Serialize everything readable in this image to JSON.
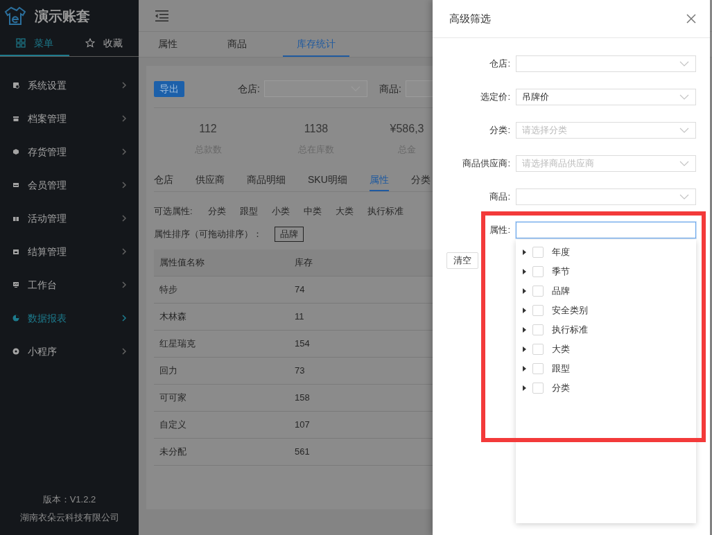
{
  "sidebar": {
    "app_name": "演示账套",
    "tabs": [
      {
        "label": "菜单",
        "selected": true
      },
      {
        "label": "收藏",
        "selected": false
      }
    ],
    "items": [
      {
        "label": "系统设置",
        "selected": false
      },
      {
        "label": "档案管理",
        "selected": false
      },
      {
        "label": "存货管理",
        "selected": false
      },
      {
        "label": "会员管理",
        "selected": false
      },
      {
        "label": "活动管理",
        "selected": false
      },
      {
        "label": "结算管理",
        "selected": false
      },
      {
        "label": "工作台",
        "selected": false
      },
      {
        "label": "数据报表",
        "selected": true
      },
      {
        "label": "小程序",
        "selected": false
      }
    ],
    "version": "版本：V1.2.2",
    "company": "湖南衣朵云科技有限公司"
  },
  "main": {
    "tabs": [
      {
        "label": "属性",
        "selected": false
      },
      {
        "label": "商品",
        "selected": false
      },
      {
        "label": "库存统计",
        "selected": true
      }
    ],
    "export_button": "导出",
    "filters": [
      {
        "label": "仓店:"
      },
      {
        "label": "商品:"
      }
    ],
    "stats": [
      {
        "value": "112",
        "label": "总款数"
      },
      {
        "value": "1138",
        "label": "总在库数"
      },
      {
        "value": "¥586,3",
        "label": "总金"
      }
    ],
    "sub_tabs": [
      {
        "label": "仓店",
        "selected": false
      },
      {
        "label": "供应商",
        "selected": false
      },
      {
        "label": "商品明细",
        "selected": false
      },
      {
        "label": "SKU明细",
        "selected": false
      },
      {
        "label": "属性",
        "selected": true
      },
      {
        "label": "分类",
        "selected": false
      }
    ],
    "optional_attributes": {
      "label": "可选属性:",
      "items": [
        "分类",
        "跟型",
        "小类",
        "中类",
        "大类",
        "执行标准"
      ]
    },
    "sort_row": {
      "label": "属性排序（可拖动排序）：",
      "tags": [
        "品牌"
      ]
    },
    "table": {
      "columns": [
        "属性值名称",
        "库存"
      ],
      "rows": [
        [
          "特步",
          "74"
        ],
        [
          "木林森",
          "11"
        ],
        [
          "红星瑞克",
          "154"
        ],
        [
          "回力",
          "73"
        ],
        [
          "可可家",
          "158"
        ],
        [
          "自定义",
          "107"
        ],
        [
          "未分配",
          "561"
        ]
      ]
    }
  },
  "drawer": {
    "title": "高级筛选",
    "fields": [
      {
        "label": "仓店:",
        "kind": "select",
        "focused": false
      },
      {
        "label": "选定价:",
        "kind": "select",
        "value": "吊牌价",
        "focused": false
      },
      {
        "label": "分类:",
        "kind": "select",
        "placeholder": "请选择分类",
        "focused": false
      },
      {
        "label": "商品供应商:",
        "kind": "select",
        "placeholder": "请选择商品供应商",
        "focused": false
      },
      {
        "label": "商品:",
        "kind": "select",
        "focused": false
      },
      {
        "label": "属性:",
        "kind": "input",
        "focused": true
      }
    ],
    "clear_button": "清空",
    "tree": [
      {
        "label": "年度",
        "checked": false
      },
      {
        "label": "季节",
        "checked": false
      },
      {
        "label": "品牌",
        "checked": false
      },
      {
        "label": "安全类别",
        "checked": false
      },
      {
        "label": "执行标准",
        "checked": false
      },
      {
        "label": "大类",
        "checked": false
      },
      {
        "label": "跟型",
        "checked": false
      },
      {
        "label": "分类",
        "checked": false
      }
    ]
  }
}
